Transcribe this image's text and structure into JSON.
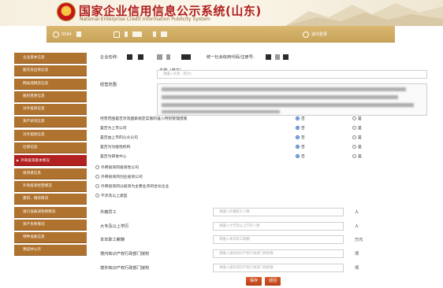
{
  "header": {
    "title_cn": "国家企业信用信息公示系统(山东)",
    "title_en": "National Enterprise Credit Information Publicity System"
  },
  "toolbar": {
    "phone_prefix": "0594",
    "logout": "退出登录"
  },
  "sidebar": {
    "items": [
      {
        "label": "企业基本信息",
        "active": false
      },
      {
        "label": "股东及出资信息",
        "active": false
      },
      {
        "label": "网站或网店信息",
        "active": false
      },
      {
        "label": "股权变更信息",
        "active": false
      },
      {
        "label": "对外投资信息",
        "active": false
      },
      {
        "label": "资产状况信息",
        "active": false
      },
      {
        "label": "对外担保信息",
        "active": false
      },
      {
        "label": "社保信息",
        "active": false
      },
      {
        "label": "外商投资基本情况",
        "active": true
      },
      {
        "label": "投资者信息",
        "active": false
      },
      {
        "label": "外商投资经营情况",
        "active": false
      },
      {
        "label": "建筑、储房情况",
        "active": false
      },
      {
        "label": "进口设备减免税情况",
        "active": false
      },
      {
        "label": "资产负债情况",
        "active": false
      },
      {
        "label": "特种设备信息",
        "active": false
      },
      {
        "label": "预览并公示",
        "active": false
      }
    ]
  },
  "main": {
    "company_name_label": "企业名称:",
    "credit_code_label": "统一社会信用代码/注册号:",
    "name_en_label": "名称（英文）",
    "name_en_placeholder": "请输入名称（英文）",
    "business_scope_label": "经营范围",
    "yes_no_questions": [
      {
        "label": "经营范围是否涉及国家规定实施的准入特别管理措施",
        "no": "否",
        "yes": "是",
        "selected": "否"
      },
      {
        "label": "是否为上市公司",
        "no": "否",
        "yes": "是",
        "selected": "否"
      },
      {
        "label": "是否由上市的公众公司",
        "no": "否",
        "yes": "是",
        "selected": "否"
      },
      {
        "label": "是否为功能性机构",
        "no": "否",
        "yes": "是",
        "selected": "否"
      },
      {
        "label": "是否为研发中心",
        "no": "否",
        "yes": "是",
        "selected": "否"
      }
    ],
    "company_types": [
      "外商投资的投资性公司",
      "外商投资的创业投资公司",
      "外商投资的以投资为主要业务的合伙企业",
      "不涉及以上类型"
    ],
    "numeric_fields": [
      {
        "label": "外籍员工",
        "placeholder": "请输入外籍职工人数",
        "unit": "人"
      },
      {
        "label": "大专及以上学历",
        "placeholder": "请输入大专及以上学历人数",
        "unit": "人"
      },
      {
        "label": "本年职工薪酬",
        "placeholder": "请输入本年职工薪酬",
        "unit": "万元"
      },
      {
        "label": "境内知识产权行政部门授权",
        "placeholder": "请输入境内知识产权行政部门授权数",
        "unit": "项"
      },
      {
        "label": "境外知识产权行政部门授权",
        "placeholder": "请输入境外知识产权行政部门授权数",
        "unit": "项"
      }
    ],
    "save_button": "保存",
    "back_button": "返回"
  },
  "colors": {
    "header_red": "#b01f1f",
    "toolbar_gold": "#d2ae64",
    "sidebar_brown": "#b0732f",
    "sidebar_active": "#b32020",
    "radio_blue": "#2f6bc1",
    "button_orange": "#c94a22"
  }
}
